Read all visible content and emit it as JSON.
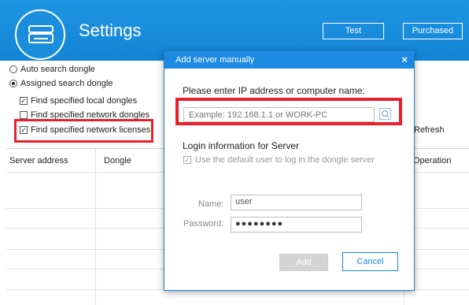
{
  "header": {
    "title": "Settings",
    "test_label": "Test",
    "purchased_label": "Purchased"
  },
  "options": {
    "auto_search": "Auto search dongle",
    "assigned_search": "Assigned search dongle",
    "find_local": "Find specified local dongles",
    "find_network_dongles": "Find specified network dongles",
    "find_network_licenses": "Find specified network licenses",
    "selected_radio": "assigned_search",
    "checked": [
      "find_local",
      "find_network_licenses"
    ]
  },
  "refresh_label": "Refresh",
  "table": {
    "columns": [
      "Server address",
      "Dongle",
      "Operation"
    ]
  },
  "dialog": {
    "title": "Add server manually",
    "close_glyph": "×",
    "ip_prompt": "Please enter IP address or computer name:",
    "ip_placeholder": "Example: 192.168.1.1 or WORK-PC",
    "login_heading": "Login information for Server",
    "default_user_label": "Use the default user to log in the dongle server",
    "name_label": "Name:",
    "name_value": "user",
    "password_label": "Password:",
    "password_value": "●●●●●●●●",
    "add_label": "Add",
    "cancel_label": "Cancel"
  },
  "colors": {
    "header_blue": "#1384d4",
    "accent_blue": "#1b8ae0",
    "highlight_red": "#e8202a"
  }
}
